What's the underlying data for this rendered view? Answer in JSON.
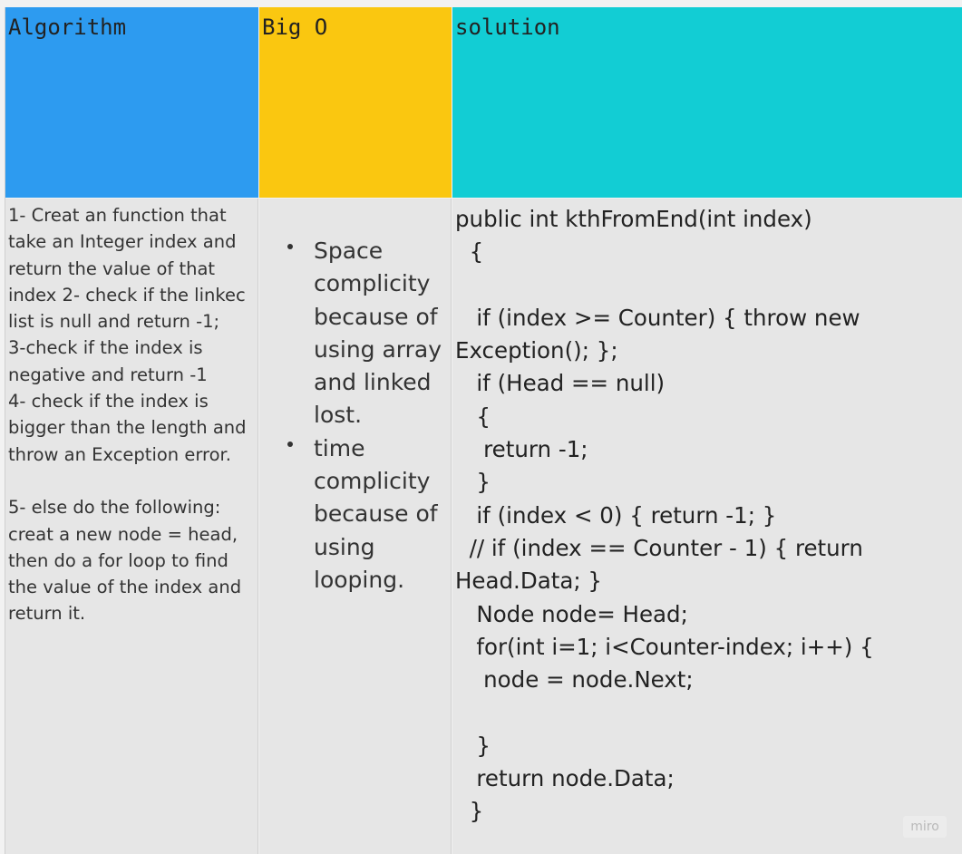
{
  "headers": {
    "algorithm": "Algorithm",
    "big_o": "Big O",
    "solution": "solution"
  },
  "algorithm_text": "1- Creat an function that\ntake an Integer index and\nreturn the value of that\nindex 2- check if the linkec\nlist is null and return -1;\n3-check if the index is\nnegative and return -1\n4- check if the index is\nbigger than the length and\nthrow an Exception error.\n\n5- else do the following:\ncreat a new node = head,\nthen do a for loop to find\nthe value of the index and\nreturn it.",
  "big_o_items": [
    "Space complicity because of using array and linked lost.",
    "time complicity because of using looping."
  ],
  "solution_code": "public int kthFromEnd(int index)\n  {\n\n   if (index >= Counter) { throw new\nException(); };\n   if (Head == null)\n   {\n    return -1;\n   }\n   if (index < 0) { return -1; }\n  // if (index == Counter - 1) { return\nHead.Data; }\n   Node node= Head;\n   for(int i=1; i<Counter-index; i++) {\n    node = node.Next;\n\n   }\n   return node.Data;\n  }",
  "watermark": "miro",
  "colors": {
    "algorithm_header": "#2d9bf0",
    "big_o_header": "#fac710",
    "solution_header": "#12cdd4",
    "cell_background": "#e6e6e6"
  }
}
